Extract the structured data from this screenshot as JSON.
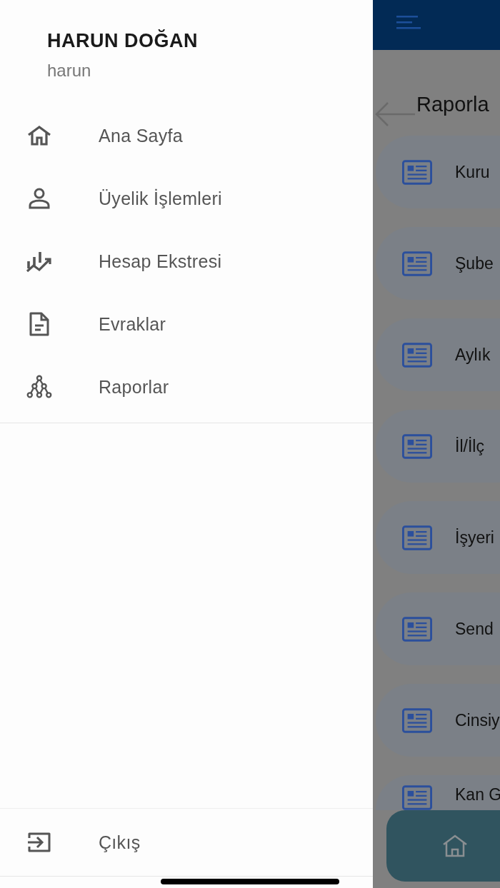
{
  "drawer": {
    "user": {
      "name": "HARUN DOĞAN",
      "username": "harun"
    },
    "menu": [
      {
        "label": "Ana Sayfa",
        "kind": "home"
      },
      {
        "label": "Üyelik İşlemleri",
        "kind": "person"
      },
      {
        "label": "Hesap Ekstresi",
        "kind": "chart"
      },
      {
        "label": "Evraklar",
        "kind": "document"
      },
      {
        "label": "Raporlar",
        "kind": "tree"
      }
    ],
    "logout": {
      "label": "Çıkış"
    }
  },
  "background_screen": {
    "title": "Raporla",
    "reports": [
      {
        "label": "Kuru"
      },
      {
        "label": "Şube"
      },
      {
        "label": "Aylık"
      },
      {
        "label": "İl/İlç"
      },
      {
        "label": "İşyeri"
      },
      {
        "label": "Send"
      },
      {
        "label": "Cinsiy"
      },
      {
        "label": "Kan G"
      }
    ]
  }
}
